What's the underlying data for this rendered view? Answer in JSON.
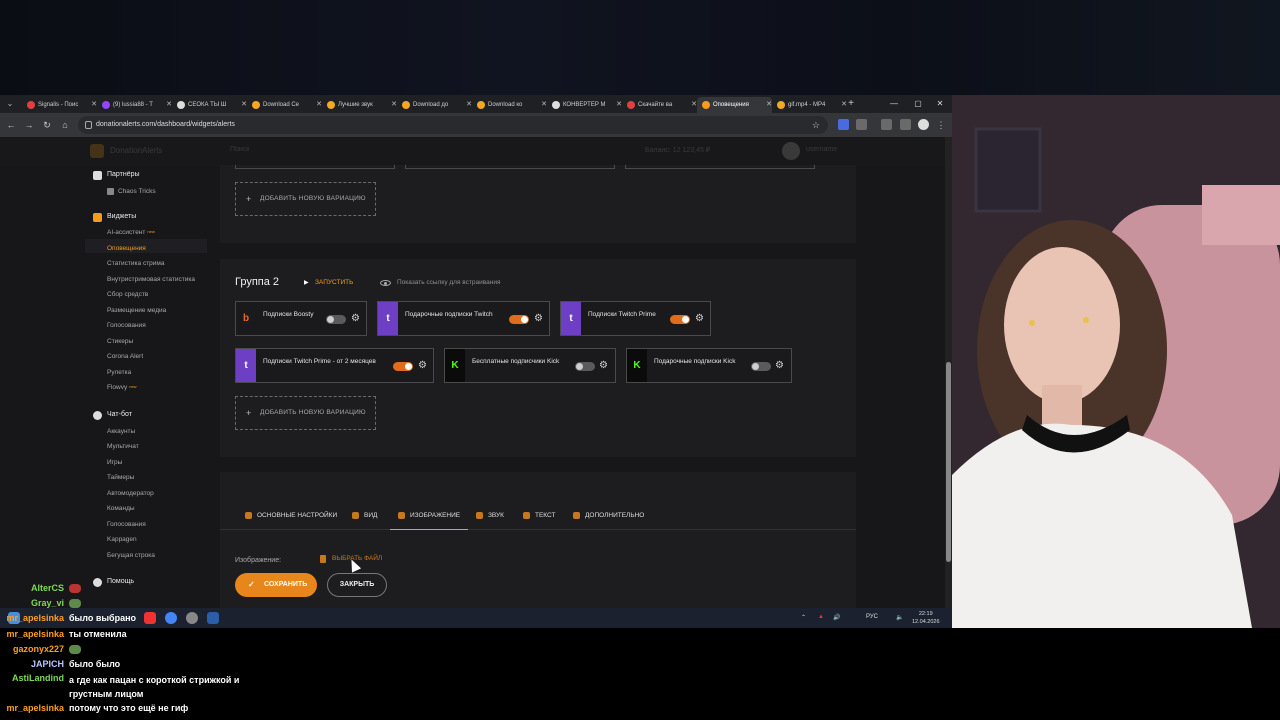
{
  "browser": {
    "tabs": [
      {
        "label": "Signalis - Поис",
        "color": "#e04040"
      },
      {
        "label": "(9) lussia88 - T",
        "color": "#9146ff"
      },
      {
        "label": "СЕОКА ТЫ Ш",
        "color": "#dddddd"
      },
      {
        "label": "Download Ce",
        "color": "#f5a623"
      },
      {
        "label": "Лучшие звук",
        "color": "#f5a623"
      },
      {
        "label": "Download до",
        "color": "#f5a623"
      },
      {
        "label": "Download ко",
        "color": "#f5a623"
      },
      {
        "label": "КОНВЕРТЕР М",
        "color": "#dddddd"
      },
      {
        "label": "Скачайте ва",
        "color": "#e04040"
      },
      {
        "label": "Оповещения",
        "color": "#f59c1a"
      },
      {
        "label": "gif.mp4 - MP4",
        "color": "#f5a623"
      }
    ],
    "url": "donationalerts.com/dashboard/widgets/alerts"
  },
  "header": {
    "site_name": "DonationAlerts",
    "search": "Поиск",
    "balance": "Баланс: 12 123,45 ₽",
    "username": "username"
  },
  "sidebar": {
    "partners": {
      "label": "Партнёры",
      "items": [
        {
          "label": "Chaos Tricks"
        }
      ]
    },
    "widgets": {
      "label": "Виджеты",
      "items": [
        {
          "label": "AI-ассистент",
          "badge": "new"
        },
        {
          "label": "Оповещения"
        },
        {
          "label": "Статистика стрима"
        },
        {
          "label": "Внутристримовая статистика"
        },
        {
          "label": "Сбор средств"
        },
        {
          "label": "Размещение медиа"
        },
        {
          "label": "Голосования"
        },
        {
          "label": "Стикеры"
        },
        {
          "label": "Corona Alert"
        },
        {
          "label": "Рулетка"
        },
        {
          "label": "Flowvy",
          "badge": "new"
        }
      ]
    },
    "chatbot": {
      "label": "Чат-бот",
      "items": [
        {
          "label": "Аккаунты"
        },
        {
          "label": "Мультичат"
        },
        {
          "label": "Игры"
        },
        {
          "label": "Таймеры"
        },
        {
          "label": "Автомодератор"
        },
        {
          "label": "Команды"
        },
        {
          "label": "Голосования"
        },
        {
          "label": "Kappagen"
        },
        {
          "label": "Бегущая строка"
        }
      ]
    },
    "help": {
      "label": "Помощь"
    }
  },
  "content": {
    "add_variation": "ДОБАВИТЬ НОВУЮ ВАРИАЦИЮ",
    "group2": {
      "title": "Группа 2",
      "run": "ЗАПУСТИТЬ",
      "embed_link": "Показать ссылку для встраивания",
      "tiles": [
        {
          "label": "Подписки Boosty",
          "badge": "b",
          "badge_color": "#e8682a",
          "on": false
        },
        {
          "label": "Подарочные подписки Twitch",
          "badge": "t",
          "badge_color": "#9146ff",
          "on": true
        },
        {
          "label": "Подписки Twitch Prime",
          "badge": "t",
          "badge_color": "#9146ff",
          "on": true
        },
        {
          "label": "Подписки Twitch Prime - от 2 месяцев",
          "badge": "t",
          "badge_color": "#9146ff",
          "on": true
        },
        {
          "label": "Бесплатные подписчики Kick",
          "badge": "K",
          "badge_color": "#53fc18",
          "on": false
        },
        {
          "label": "Подарочные подписки Kick",
          "badge": "K",
          "badge_color": "#53fc18",
          "on": false
        }
      ]
    },
    "settings_tabs": [
      {
        "label": "ОСНОВНЫЕ НАСТРОЙКИ"
      },
      {
        "label": "ВИД"
      },
      {
        "label": "ИЗОБРАЖЕНИЕ"
      },
      {
        "label": "ЗВУК"
      },
      {
        "label": "ТЕКСТ"
      },
      {
        "label": "ДОПОЛНИТЕЛЬНО"
      }
    ],
    "image_label": "Изображение:",
    "choose_file": "ВЫБРАТЬ ФАЙЛ",
    "save": "СОХРАНИТЬ",
    "close": "ЗАКРЫТЬ"
  },
  "taskbar": {
    "lang": "РУС",
    "time": "22:19",
    "date": "12.04.2026"
  },
  "chat": [
    {
      "user": "AlterCS",
      "user_color": "#7ed957",
      "msg": ""
    },
    {
      "user": "Gray_vi",
      "user_color": "#7ed957",
      "msg": ""
    },
    {
      "user": "mr_apelsinka",
      "user_color": "#ff9f1c",
      "msg": "было выбрано"
    },
    {
      "user": "mr_apelsinka",
      "user_color": "#ff9f1c",
      "msg": "ты отменила"
    },
    {
      "user": "gazonyx227",
      "user_color": "#ff9f1c",
      "msg": ""
    },
    {
      "user": "JAPICH",
      "user_color": "#b8c7ff",
      "msg": "было было"
    },
    {
      "user": "AstiLandind",
      "user_color": "#7ed957",
      "msg": "а где как пацан с короткой стрижкой и грустным лицом"
    },
    {
      "user": "mr_apelsinka",
      "user_color": "#ff9f1c",
      "msg": "потому что это ещё не гиф"
    }
  ],
  "colors": {
    "accent": "#f59c1a",
    "save_button": "#e7861b",
    "toggle_on": "#e06c1c"
  }
}
